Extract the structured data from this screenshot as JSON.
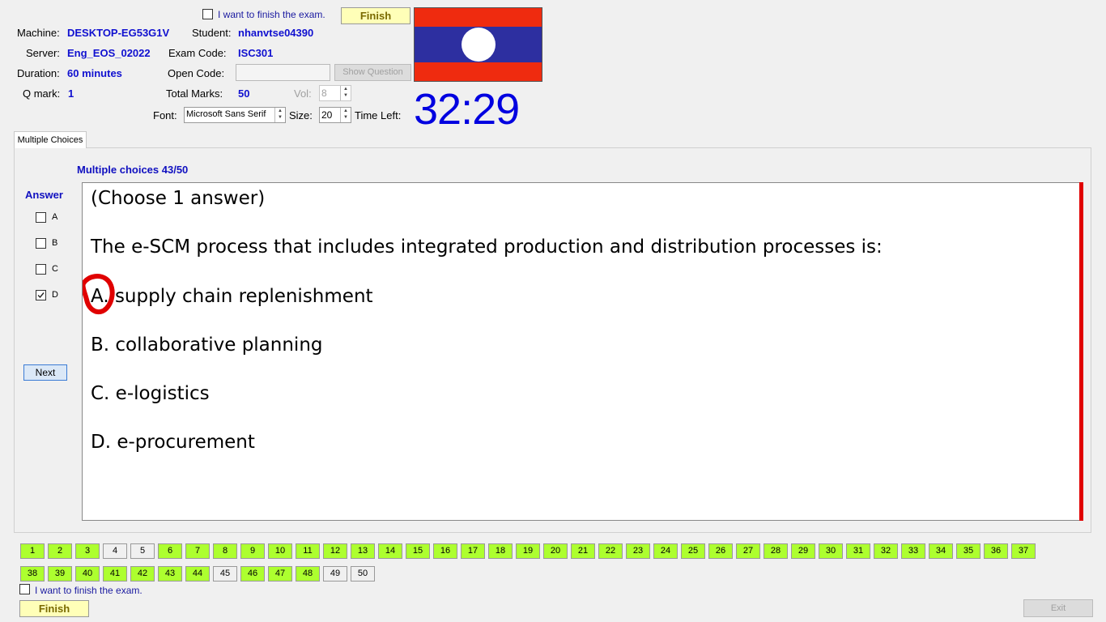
{
  "header": {
    "finish_check_label": "I want to finish the exam.",
    "finish_button": "Finish",
    "machine_label": "Machine:",
    "machine_value": "DESKTOP-EG53G1V",
    "student_label": "Student:",
    "student_value": "nhanvtse04390",
    "server_label": "Server:",
    "server_value": "Eng_EOS_02022",
    "exam_code_label": "Exam Code:",
    "exam_code_value": "ISC301",
    "duration_label": "Duration:",
    "duration_value": "60 minutes",
    "open_code_label": "Open Code:",
    "open_code_value": "",
    "show_question_button": "Show Question",
    "qmark_label": "Q mark:",
    "qmark_value": "1",
    "total_marks_label": "Total Marks:",
    "total_marks_value": "50",
    "vol_label": "Vol:",
    "vol_value": "8",
    "font_label": "Font:",
    "font_value": "Microsoft Sans Serif",
    "size_label": "Size:",
    "size_value": "20",
    "time_left_label": "Time Left:",
    "timer": "32:29"
  },
  "tab": {
    "label": "Multiple Choices"
  },
  "question": {
    "progress": "Multiple choices 43/50",
    "answer_label": "Answer",
    "options": [
      {
        "letter": "A",
        "checked": false
      },
      {
        "letter": "B",
        "checked": false
      },
      {
        "letter": "C",
        "checked": false
      },
      {
        "letter": "D",
        "checked": true
      }
    ],
    "next_button": "Next",
    "instruction": "(Choose 1 answer)",
    "stem": "The e-SCM process that includes integrated production and distribution processes is:",
    "choices": [
      "A.  supply chain replenishment",
      "B.  collaborative planning",
      "C.  e-logistics",
      "D.  e-procurement"
    ]
  },
  "navigation": {
    "questions": [
      1,
      2,
      3,
      4,
      5,
      6,
      7,
      8,
      9,
      10,
      11,
      12,
      13,
      14,
      15,
      16,
      17,
      18,
      19,
      20,
      21,
      22,
      23,
      24,
      25,
      26,
      27,
      28,
      29,
      30,
      31,
      32,
      33,
      34,
      35,
      36,
      37,
      38,
      39,
      40,
      41,
      42,
      43,
      44,
      45,
      46,
      47,
      48,
      49,
      50
    ],
    "unanswered": [
      4,
      5,
      45,
      49,
      50
    ]
  },
  "footer": {
    "finish_check_label": "I want to finish the exam.",
    "finish_button": "Finish",
    "exit_button": "Exit"
  },
  "colors": {
    "answered": "#adff2f",
    "value_text": "#1010d0",
    "timer": "#0000e0",
    "flag_red": "#ef2b0f",
    "flag_blue": "#2d2fa0",
    "scrollbar_red": "#e00000"
  },
  "icons": [
    "laos-flag-image",
    "check-icon",
    "spin-arrows-icon",
    "red-circle-annotation"
  ]
}
